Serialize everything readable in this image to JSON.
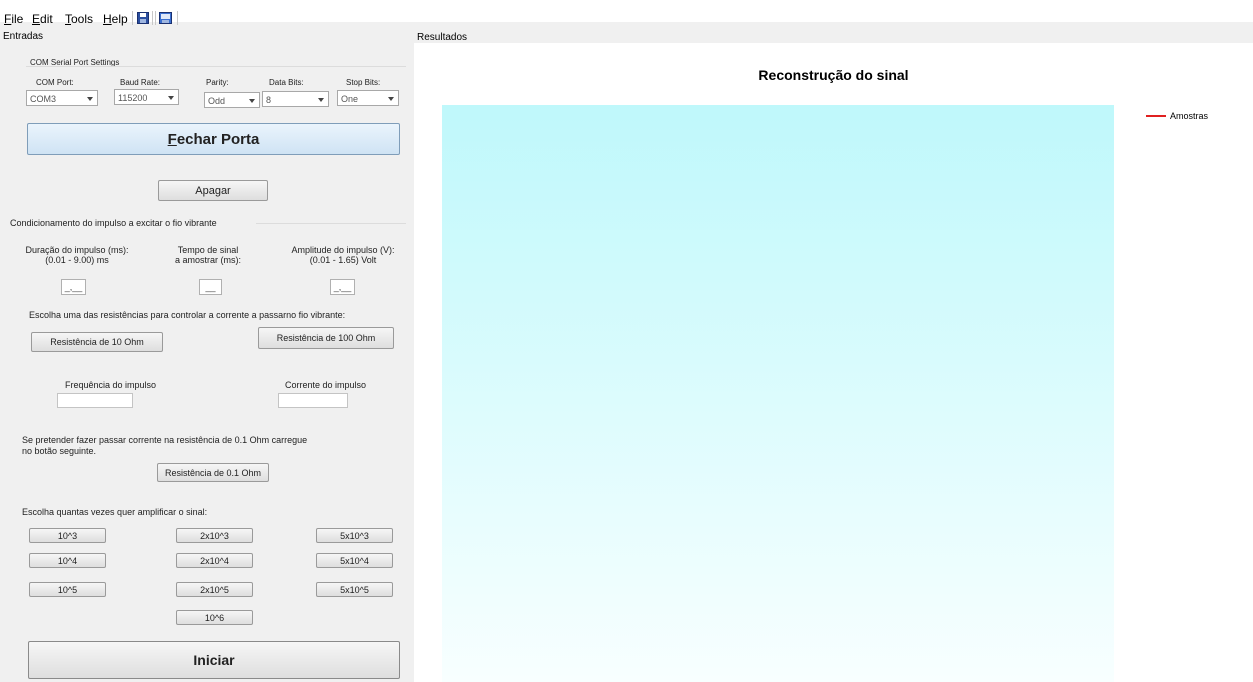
{
  "menu": {
    "file": "File",
    "edit": "Edit",
    "tools": "Tools",
    "help": "Help"
  },
  "toolbar": {
    "icons": [
      "save-icon",
      "save-image-icon"
    ]
  },
  "left_panel": {
    "title": "Entradas",
    "serial": {
      "group_title": "COM Serial Port Settings",
      "com_port_label": "COM Port:",
      "baud_rate_label": "Baud Rate:",
      "parity_label": "Parity:",
      "data_bits_label": "Data Bits:",
      "stop_bits_label": "Stop Bits:",
      "com_port_value": "COM3",
      "baud_rate_value": "115200",
      "parity_value": "Odd",
      "data_bits_value": "8",
      "stop_bits_value": "One"
    },
    "close_port_button": "Fechar Porta",
    "close_port_mnemonic": "F",
    "close_port_rest": "echar Porta",
    "clear_button": "Apagar",
    "impulse": {
      "group_title": "Condicionamento do impulso a excitar o fio vibrante",
      "duration_label_1": "Duração do impulso (ms):",
      "duration_label_2": "(0.01 - 9.00) ms",
      "time_label_1": "Tempo de sinal",
      "time_label_2": "a amostrar (ms):",
      "amplitude_label_1": "Amplitude do impulso (V):",
      "amplitude_label_2": "(0.01 - 1.65) Volt",
      "duration_mask": "_,__",
      "time_mask": "__",
      "amplitude_mask": "_,__",
      "resistor_prompt": "Escolha uma das resistências para controlar a corrente a passarno fio vibrante:",
      "res10_button": "Resistência de 10 Ohm",
      "res100_button": "Resistência de 100 Ohm",
      "frequency_label": "Frequência do impulso",
      "current_label": "Corrente do impulso",
      "frequency_value": "",
      "current_value": "",
      "res01_prompt_1": "Se pretender fazer passar corrente na resistência de 0.1 Ohm carregue",
      "res01_prompt_2": "no botão seguinte.",
      "res01_button": "Resistência de 0.1 Ohm",
      "amplify_prompt": "Escolha quantas vezes quer amplificar o sinal:",
      "gain_buttons": {
        "g1e3": "10^3",
        "g2e3": "2x10^3",
        "g5e3": "5x10^3",
        "g1e4": "10^4",
        "g2e4": "2x10^4",
        "g5e4": "5x10^4",
        "g1e5": "10^5",
        "g2e5": "2x10^5",
        "g5e5": "5x10^5",
        "g1e6": "10^6"
      }
    },
    "start_button": "Iniciar"
  },
  "right_panel": {
    "title": "Resultados"
  },
  "chart_data": {
    "type": "line",
    "title": "Reconstrução do sinal",
    "series": [
      {
        "name": "Amostras",
        "values": [],
        "color": "#e02020"
      }
    ],
    "legend": "top-right",
    "plot_background_top": "#bff8fb",
    "plot_background_bottom": "#f8ffff"
  }
}
